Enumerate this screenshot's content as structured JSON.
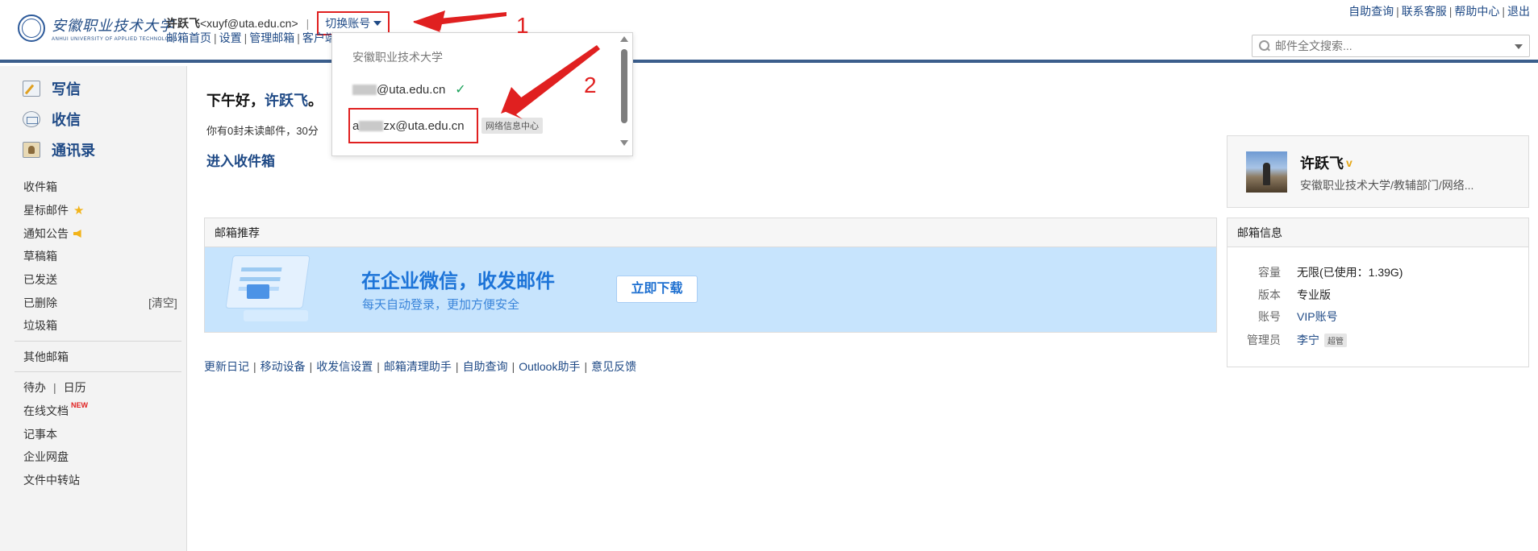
{
  "header": {
    "logo_cn": "安徽职业技术大学",
    "logo_en": "ANHUI UNIVERSITY OF APPLIED TECHNOLOGY",
    "user_name": "许跃飞",
    "user_email": "<xuyf@uta.edu.cn>",
    "separator": "|",
    "switch_label": "切换账号",
    "nav": [
      "邮箱首页",
      "设置",
      "管理邮箱",
      "客户端"
    ],
    "top_links": [
      "自助查询",
      "联系客服",
      "帮助中心",
      "退出"
    ],
    "search_placeholder": "邮件全文搜索..."
  },
  "sidebar": {
    "primary": [
      {
        "label": "写信",
        "icon": "compose-icon"
      },
      {
        "label": "收信",
        "icon": "inbox-icon"
      },
      {
        "label": "通讯录",
        "icon": "contacts-icon"
      }
    ],
    "folders": [
      "收件箱",
      "星标邮件",
      "通知公告",
      "草稿箱",
      "已发送",
      "已删除",
      "垃圾箱"
    ],
    "clear_label": "[清空]",
    "other_mailbox": "其他邮箱",
    "todo": "待办",
    "calendar": "日历",
    "online_docs": "在线文档",
    "new_tag": "NEW",
    "notepad": "记事本",
    "netdisk": "企业网盘",
    "transfer": "文件中转站"
  },
  "main": {
    "greeting_prefix": "下午好，",
    "greeting_name": "许跃飞",
    "greeting_suffix": "。",
    "unread_text": "你有0封未读邮件，30分",
    "enter_inbox": "进入收件箱",
    "promo_title": "邮箱推荐",
    "banner_title": "在企业微信，收发邮件",
    "banner_sub": "每天自动登录，更加方便安全",
    "banner_button": "立即下载",
    "footer_links": [
      "更新日记",
      "移动设备",
      "收发信设置",
      "邮箱清理助手",
      "自助查询",
      "Outlook助手",
      "意见反馈"
    ]
  },
  "profile": {
    "name": "许跃飞",
    "badge": "v",
    "org": "安徽职业技术大学/教辅部门/网络..."
  },
  "mailinfo": {
    "title": "邮箱信息",
    "rows": [
      {
        "k": "容量",
        "v": "无限(已使用：1.39G)"
      },
      {
        "k": "版本",
        "v": "专业版"
      },
      {
        "k": "账号",
        "v": "VIP账号"
      },
      {
        "k": "管理员",
        "v": "李宁"
      }
    ],
    "admin_badge": "超管"
  },
  "dropdown": {
    "org": "安徽职业技术大学",
    "account1_suffix": "@uta.edu.cn",
    "account2_prefix": "a",
    "account2_suffix": "zx@uta.edu.cn",
    "account2_tag": "网络信息中心"
  },
  "annotations": {
    "step1": "1",
    "step2": "2",
    "color": "#e02020"
  }
}
